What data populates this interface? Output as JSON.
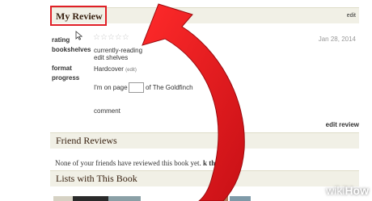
{
  "my_review": {
    "title": "My Review",
    "edit_label": "edit",
    "rating_label": "rating",
    "stars": "☆☆☆☆☆",
    "date": "Jan 28, 2014",
    "bookshelves_label": "bookshelves",
    "bookshelves_value": "currently-reading",
    "edit_shelves_label": "edit shelves",
    "format_label": "format",
    "format_value": "Hardcover",
    "format_edit_label": "(edit)",
    "progress_label": "progress",
    "progress_prefix": "I'm on page",
    "progress_suffix": "of The Goldfinch",
    "comment_label": "comment",
    "edit_review_label": "edit review"
  },
  "friend_reviews": {
    "title": "Friend Reviews",
    "text": "None of your friends have reviewed this book yet.",
    "link_fragment": "k them »"
  },
  "lists": {
    "title": "Lists with This Book"
  },
  "watermark": {
    "wiki": "wiki",
    "how": "How"
  },
  "colors": {
    "arrow": "#e01f26",
    "highlight_box": "#e01f26",
    "header_bg": "#f1f0e6"
  }
}
